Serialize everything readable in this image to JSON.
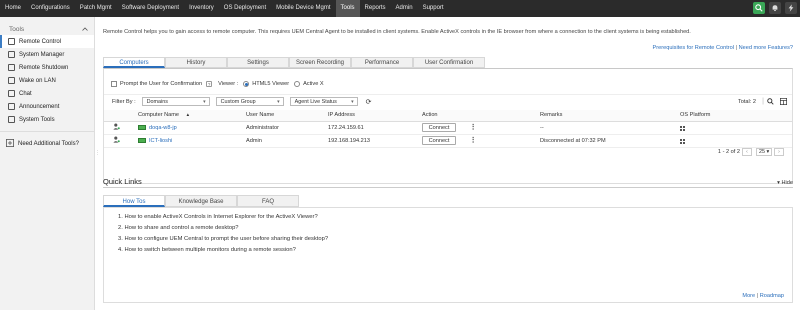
{
  "topnav": {
    "items": [
      {
        "label": "Home"
      },
      {
        "label": "Configurations"
      },
      {
        "label": "Patch Mgmt"
      },
      {
        "label": "Software Deployment"
      },
      {
        "label": "Inventory"
      },
      {
        "label": "OS Deployment"
      },
      {
        "label": "Mobile Device Mgmt"
      },
      {
        "label": "Tools",
        "active": true
      },
      {
        "label": "Reports"
      },
      {
        "label": "Admin"
      },
      {
        "label": "Support"
      }
    ],
    "right_icons": [
      "search-icon",
      "bell-icon",
      "lightning-icon"
    ]
  },
  "sidebar": {
    "title": "Tools",
    "items": [
      {
        "label": "Remote Control",
        "active": true
      },
      {
        "label": "System Manager"
      },
      {
        "label": "Remote Shutdown"
      },
      {
        "label": "Wake on LAN"
      },
      {
        "label": "Chat"
      },
      {
        "label": "Announcement"
      },
      {
        "label": "System Tools"
      }
    ],
    "need_tools": "Need Additional Tools?"
  },
  "main": {
    "intro": "Remote Control helps you to gain access to remote computer. This requires UEM Central Agent to be installed in client systems. Enable ActiveX controls in the IE browser from where a connection to the client systems is being established.",
    "prereq_link": "Prerequisites for Remote Control",
    "prereq_sep": "|",
    "features_link": "Need more Features?",
    "tabs": [
      {
        "label": "Computers",
        "active": true
      },
      {
        "label": "History"
      },
      {
        "label": "Settings"
      },
      {
        "label": "Screen Recording"
      },
      {
        "label": "Performance"
      },
      {
        "label": "User Confirmation"
      }
    ],
    "options": {
      "prompt_label": "Prompt the User for Confirmation",
      "help": "?",
      "viewer_label": "Viewer :",
      "html5_label": "HTML5 Viewer",
      "activex_label": "Active X"
    },
    "filter": {
      "label": "Filter By :",
      "domains": "Domains",
      "custom_group": "Custom Group",
      "agent_status": "Agent Live Status",
      "total": "Total: 2"
    },
    "table": {
      "headers": [
        "Computer Name",
        "User Name",
        "IP Address",
        "Action",
        "Remarks",
        "OS Platform"
      ],
      "sort_indicator": "▲",
      "rows": [
        {
          "computer": "doqa-w8-jp",
          "user": "Administrator",
          "ip": "172.24.159.61",
          "action": "Connect",
          "remarks": "--"
        },
        {
          "computer": "ICT-lioshi",
          "user": "Admin",
          "ip": "192.168.194.213",
          "action": "Connect",
          "remarks": "Disconnected at 07:32 PM"
        }
      ]
    },
    "pager": {
      "range": "1 - 2 of 2",
      "per_page": "25"
    }
  },
  "quick_links": {
    "title": "Quick Links",
    "hide": "Hide",
    "tabs": [
      {
        "label": "How Tos",
        "active": true
      },
      {
        "label": "Knowledge Base"
      },
      {
        "label": "FAQ"
      }
    ],
    "items": [
      "1. How to enable ActiveX Controls in Internet Explorer for the ActiveX Viewer?",
      "2. How to share and control a remote desktop?",
      "3. How to configure UEM Central to prompt the user before sharing their desktop?",
      "4. How to switch between multiple monitors during a remote session?"
    ],
    "more": "More",
    "more_sep": "|",
    "roadmap": "Roadmap"
  },
  "colors": {
    "accent": "#2a6ebb",
    "nav_bg": "#2b2b2b",
    "green_button": "#3aa757"
  }
}
